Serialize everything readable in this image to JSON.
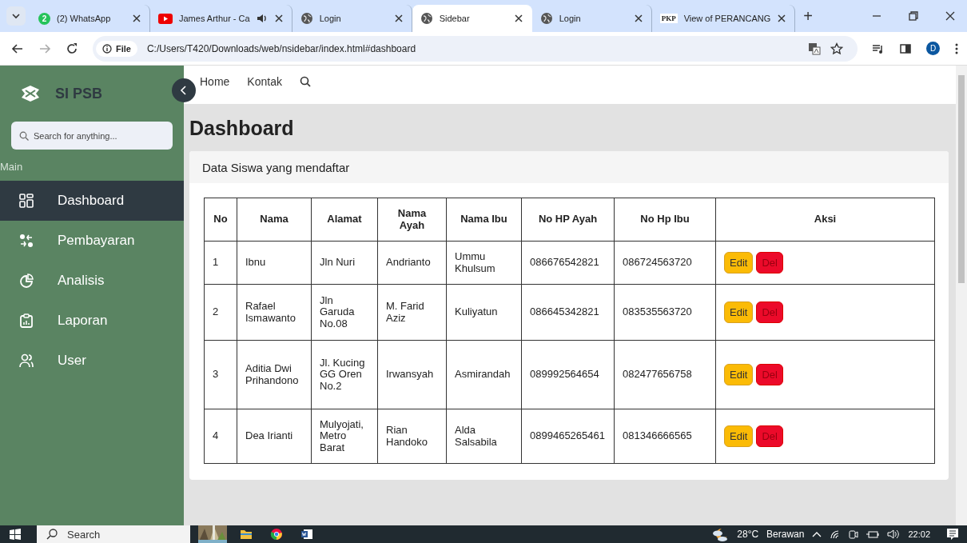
{
  "browser": {
    "tabs": [
      {
        "title": "(2) WhatsApp",
        "kind": "chat",
        "badge": "2",
        "selected": false,
        "audio": false
      },
      {
        "title": "James Arthur - Ca",
        "kind": "video",
        "selected": false,
        "audio": true
      },
      {
        "title": "Login",
        "kind": "web",
        "selected": false,
        "audio": false
      },
      {
        "title": "Sidebar",
        "kind": "web",
        "selected": true,
        "audio": false
      },
      {
        "title": "Login",
        "kind": "web",
        "selected": false,
        "audio": false
      },
      {
        "title": "View of PERANCANG",
        "kind": "journal",
        "icon_text": "PKP",
        "selected": false,
        "audio": false
      }
    ],
    "new_tab": "+",
    "file_chip": "File",
    "url": "C:/Users/T420/Downloads/web/nsidebar/index.html#dashboard",
    "profile": "D"
  },
  "sidebar": {
    "brand": "SI PSB",
    "search": {
      "placeholder": "Search for anything..."
    },
    "section": "Main",
    "items": [
      {
        "label": "Dashboard",
        "kind": "dashboard",
        "selected": true
      },
      {
        "label": "Pembayaran",
        "kind": "payment",
        "selected": false
      },
      {
        "label": "Analisis",
        "kind": "analysis",
        "selected": false
      },
      {
        "label": "Laporan",
        "kind": "report",
        "selected": false
      },
      {
        "label": "User",
        "kind": "user",
        "selected": false
      }
    ]
  },
  "topnav": {
    "links": [
      "Home",
      "Kontak"
    ]
  },
  "page": {
    "title": "Dashboard",
    "card_title": "Data Siswa yang mendaftar",
    "table": {
      "columns": [
        "No",
        "Nama",
        "Alamat",
        "Nama Ayah",
        "Nama Ibu",
        "No HP Ayah",
        "No Hp Ibu",
        "Aksi"
      ],
      "rows": [
        {
          "cells": [
            "1",
            "Ibnu",
            "Jln Nuri",
            "Andrianto",
            "Ummu Khulsum",
            "086676542821",
            "086724563720"
          ],
          "actions": [
            "Edit",
            "Del"
          ]
        },
        {
          "cells": [
            "2",
            "Rafael Ismawanto",
            "Jln Garuda No.08",
            "M. Farid Aziz",
            "Kuliyatun",
            "086645342821",
            "083535563720"
          ],
          "actions": [
            "Edit",
            "Del"
          ]
        },
        {
          "cells": [
            "3",
            "Aditia Dwi Prihandono",
            "Jl. Kucing GG Oren No.2",
            "Irwansyah",
            "Asmirandah",
            "089992564654",
            "082477656758"
          ],
          "actions": [
            "Edit",
            "Del"
          ]
        },
        {
          "cells": [
            "4",
            "Dea Irianti",
            "Mulyojati, Metro Barat",
            "Rian Handoko",
            "Alda Salsabila",
            "0899465265461",
            "081346666565"
          ],
          "actions": [
            "Edit",
            "Del"
          ]
        }
      ]
    }
  },
  "taskbar": {
    "search": "Search",
    "temperature": "28°C",
    "weather": "Berawan",
    "time": "22:02"
  }
}
